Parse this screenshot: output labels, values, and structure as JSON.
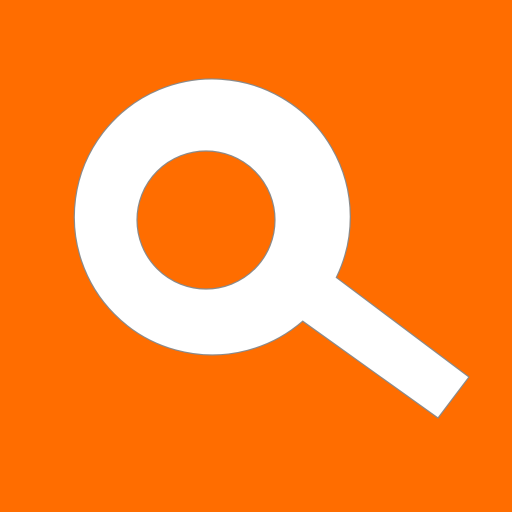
{
  "icon": {
    "name": "search-icon",
    "description_shape": "magnifying-glass"
  },
  "colors": {
    "background": "#FF6D00",
    "glyph": "#FFFFFF",
    "outline": "#8A8A8A"
  }
}
